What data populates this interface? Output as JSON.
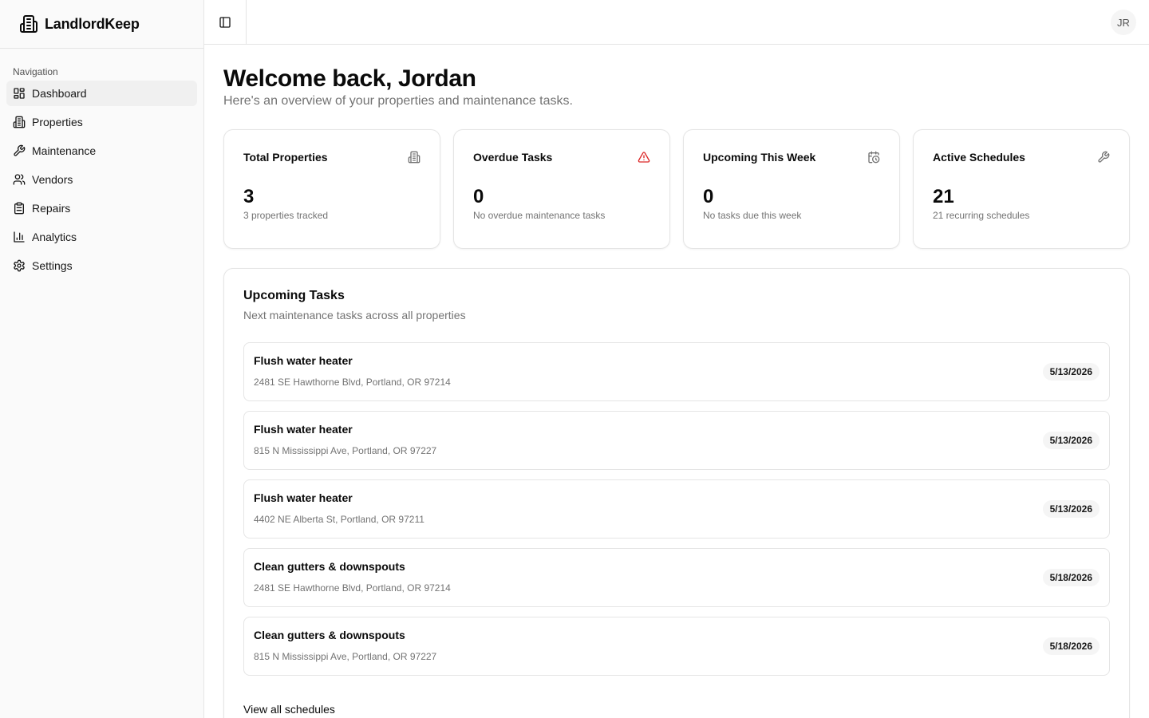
{
  "app": {
    "name": "LandlordKeep"
  },
  "sidebar": {
    "group_label": "Navigation",
    "items": [
      {
        "label": "Dashboard",
        "icon": "dashboard-icon",
        "active": true
      },
      {
        "label": "Properties",
        "icon": "building-icon"
      },
      {
        "label": "Maintenance",
        "icon": "wrench-icon"
      },
      {
        "label": "Vendors",
        "icon": "users-icon"
      },
      {
        "label": "Repairs",
        "icon": "clipboard-icon"
      },
      {
        "label": "Analytics",
        "icon": "bar-chart-icon"
      },
      {
        "label": "Settings",
        "icon": "gear-icon"
      }
    ]
  },
  "header": {
    "avatar_initials": "JR"
  },
  "main": {
    "title": "Welcome back, Jordan",
    "subtitle": "Here's an overview of your properties and maintenance tasks.",
    "stats": [
      {
        "title": "Total Properties",
        "value": "3",
        "desc": "3 properties tracked",
        "icon": "building-icon"
      },
      {
        "title": "Overdue Tasks",
        "value": "0",
        "desc": "No overdue maintenance tasks",
        "icon": "alert-triangle-icon",
        "icon_color": "#dc2626"
      },
      {
        "title": "Upcoming This Week",
        "value": "0",
        "desc": "No tasks due this week",
        "icon": "calendar-clock-icon"
      },
      {
        "title": "Active Schedules",
        "value": "21",
        "desc": "21 recurring schedules",
        "icon": "wrench-icon"
      }
    ],
    "upcoming": {
      "title": "Upcoming Tasks",
      "subtitle": "Next maintenance tasks across all properties",
      "tasks": [
        {
          "name": "Flush water heater",
          "address": "2481 SE Hawthorne Blvd, Portland, OR 97214",
          "date": "5/13/2026"
        },
        {
          "name": "Flush water heater",
          "address": "815 N Mississippi Ave, Portland, OR 97227",
          "date": "5/13/2026"
        },
        {
          "name": "Flush water heater",
          "address": "4402 NE Alberta St, Portland, OR 97211",
          "date": "5/13/2026"
        },
        {
          "name": "Clean gutters & downspouts",
          "address": "2481 SE Hawthorne Blvd, Portland, OR 97214",
          "date": "5/18/2026"
        },
        {
          "name": "Clean gutters & downspouts",
          "address": "815 N Mississippi Ave, Portland, OR 97227",
          "date": "5/18/2026"
        }
      ],
      "view_all_label": "View all schedules"
    }
  }
}
